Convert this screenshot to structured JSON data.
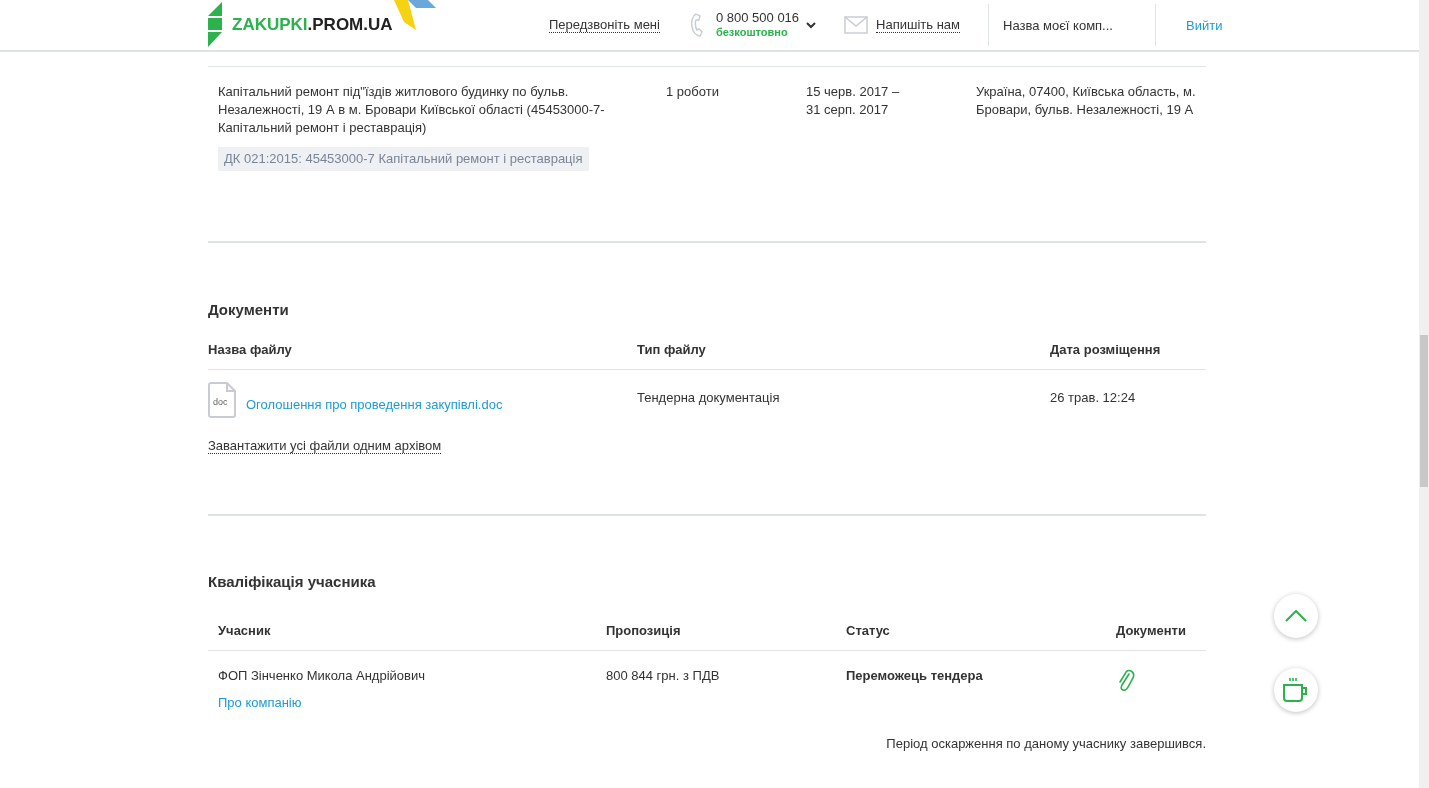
{
  "header": {
    "logo": {
      "brand": "ZAKUPKI",
      "domain": ".PROM.UA"
    },
    "callback": "Передзвоніть мені",
    "phone": {
      "number": "0 800 500 016",
      "note": "безкоштовно"
    },
    "write_us": "Напишіть нам",
    "company": "Назва моєї комп...",
    "logout": "Вийти"
  },
  "items": [
    {
      "name": "Капітальний ремонт під\"їздів житлового будинку по бульв. Незалежності, 19 А в м. Бровари Київської області (45453000-7- Капітальний ремонт і реставрація)",
      "quantity": "1 роботи",
      "period": "15 черв. 2017 – 31 серп. 2017",
      "address": "Україна, 07400, Київська область, м. Бровари, бульв. Незалежності, 19 А",
      "classifier": "ДК 021:2015: 45453000-7 Капітальний ремонт і реставрація"
    }
  ],
  "documents": {
    "title": "Документи",
    "columns": [
      "Назва файлу",
      "Тип файлу",
      "Дата розміщення"
    ],
    "rows": [
      {
        "file_type_icon": "doc",
        "name": "Оголошення про проведення закупівлі.doc",
        "type": "Тендерна документація",
        "date": "26 трав. 12:24"
      }
    ],
    "download_all": "Завантажити усі файли одним архівом"
  },
  "qualification": {
    "title": "Кваліфікація учасника",
    "columns": [
      "Учасник",
      "Пропозиція",
      "Статус",
      "Документи"
    ],
    "rows": [
      {
        "participant": "ФОП Зінченко Микола Андрійович",
        "about_link": "Про компанію",
        "offer": "800 844 грн. з ПДВ",
        "status": "Переможець тендера",
        "has_documents": true
      }
    ],
    "note": "Період оскарження по даному учаснику завершився."
  }
}
